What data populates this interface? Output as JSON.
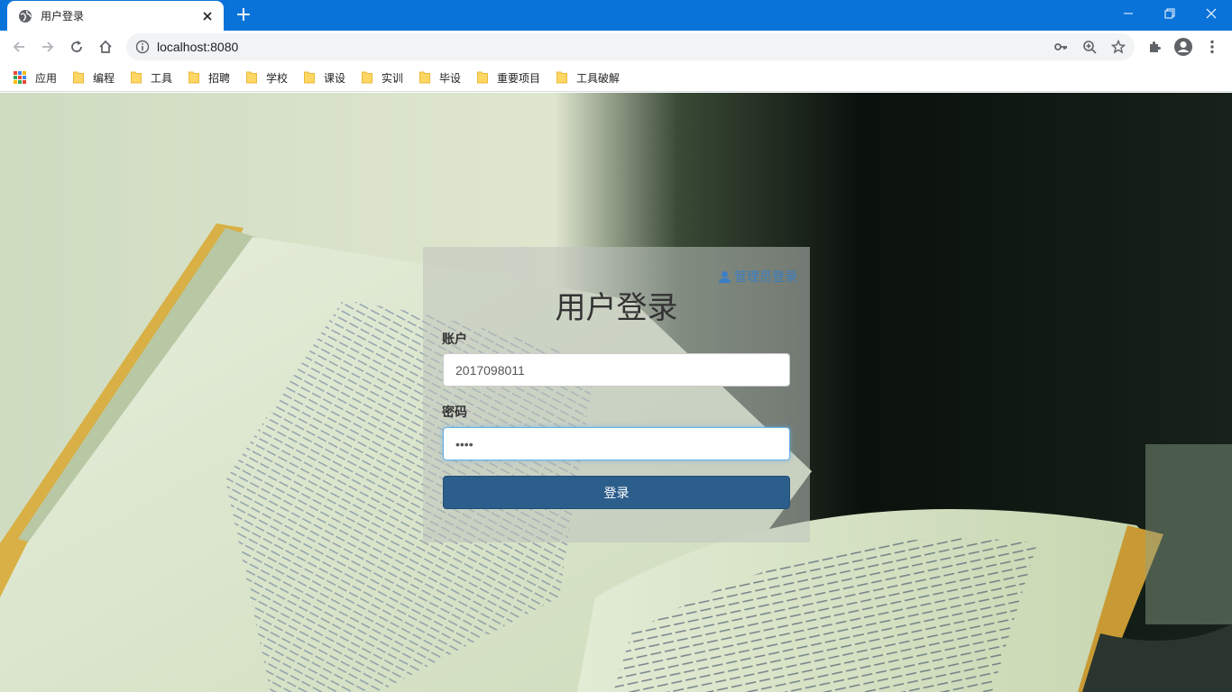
{
  "browser": {
    "tab": {
      "title": "用户登录",
      "close_icon": "close-icon",
      "favicon": "globe-icon"
    },
    "new_tab_symbol": "+",
    "window": {
      "minimize": "minimize-icon",
      "restore": "restore-icon",
      "close": "close-icon"
    },
    "address": {
      "url": "localhost:8080"
    },
    "toolbar_icons": [
      "back-icon",
      "forward-icon",
      "reload-icon",
      "home-icon",
      "key-icon",
      "zoom-icon",
      "star-icon",
      "extensions-icon",
      "profile-icon",
      "menu-icon"
    ],
    "bookmarks": [
      {
        "label": "应用",
        "icon": "apps-icon"
      },
      {
        "label": "编程",
        "icon": "folder-icon"
      },
      {
        "label": "工具",
        "icon": "folder-icon"
      },
      {
        "label": "招聘",
        "icon": "folder-icon"
      },
      {
        "label": "学校",
        "icon": "folder-icon"
      },
      {
        "label": "课设",
        "icon": "folder-icon"
      },
      {
        "label": "实训",
        "icon": "folder-icon"
      },
      {
        "label": "毕设",
        "icon": "folder-icon"
      },
      {
        "label": "重要项目",
        "icon": "folder-icon"
      },
      {
        "label": "工具破解",
        "icon": "folder-icon"
      }
    ]
  },
  "login": {
    "admin_link": "管理员登录",
    "title": "用户登录",
    "account_label": "账户",
    "account_value": "2017098011",
    "password_label": "密码",
    "password_value": "••••",
    "submit_label": "登录"
  },
  "colors": {
    "titlebar": "#0a73d9",
    "link": "#3a7ec5",
    "button": "#2c5e8c",
    "focus_border": "#66afe9"
  }
}
